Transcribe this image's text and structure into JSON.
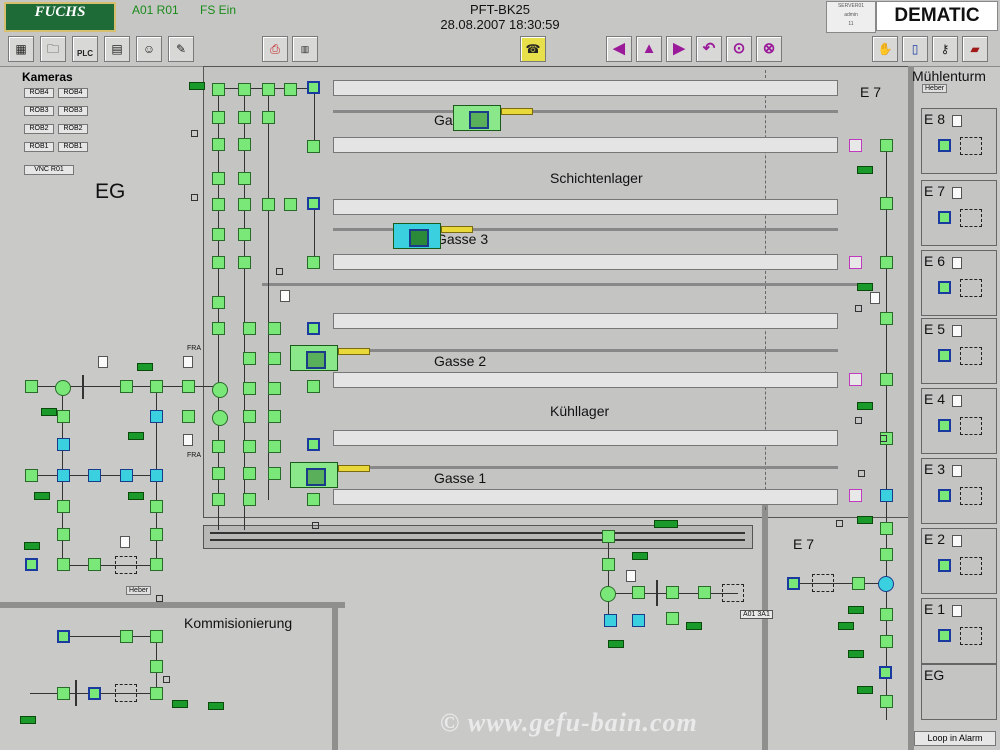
{
  "header": {
    "logo_text": "FUCHS",
    "station": "A01 R01",
    "fs_status": "FS Ein",
    "app_title": "PFT-BK25",
    "datetime": "28.08.2007   18:30:59",
    "status_lines": [
      "SERVER01",
      "admin",
      "11"
    ],
    "brand": "DEMATIC"
  },
  "toolbar": {
    "left_icons": [
      "overview-icon",
      "folder-icon",
      "plc-icon",
      "database-icon",
      "user-icon",
      "report-icon"
    ],
    "plc_label": "PLC",
    "mid_icons": [
      "printer-icon",
      "message-icon"
    ],
    "phone_icon": "phone-icon",
    "nav": [
      "◀",
      "▲",
      "▶",
      "↶",
      "⊙",
      "⊗"
    ],
    "right_icons": [
      "hand-icon",
      "door-icon",
      "key-icon",
      "book-icon"
    ]
  },
  "cameras": {
    "title": "Kameras",
    "items": [
      "ROB4",
      "ROB4",
      "ROB3",
      "ROB3",
      "ROB2",
      "ROB2",
      "ROB1",
      "ROB1"
    ],
    "vnc": "VNC R01"
  },
  "areas": {
    "eg": "EG",
    "e7_top": "E 7",
    "muehlenturm": "Mühlenturm",
    "heber_right": "Heber",
    "schichtenlager": "Schichtenlager",
    "gasse4": "Gasse",
    "gasse3": "Gasse 3",
    "gasse2": "Gasse 2",
    "kuehllager": "Kühllager",
    "gasse1": "Gasse 1",
    "e7_bottom": "E 7",
    "kommisionierung": "Kommisionierung",
    "heber_left": "Heber",
    "floors": [
      "E 8",
      "E 7",
      "E 6",
      "E 5",
      "E 4",
      "E 3",
      "E 2",
      "E 1",
      "EG"
    ],
    "id_tag": "A01 3A1",
    "fra1": "FRA",
    "fra2": "FRA"
  },
  "footer": {
    "loop_alarm": "Loop in Alarm",
    "watermark": "© www.gefu-bain.com"
  },
  "colors": {
    "conveyor": "#7ae878",
    "conveyor_active": "#3ad0e0",
    "accent_blue": "#1a3aa0",
    "nav_purple": "#9a1a9a",
    "background": "#c9cac8"
  }
}
